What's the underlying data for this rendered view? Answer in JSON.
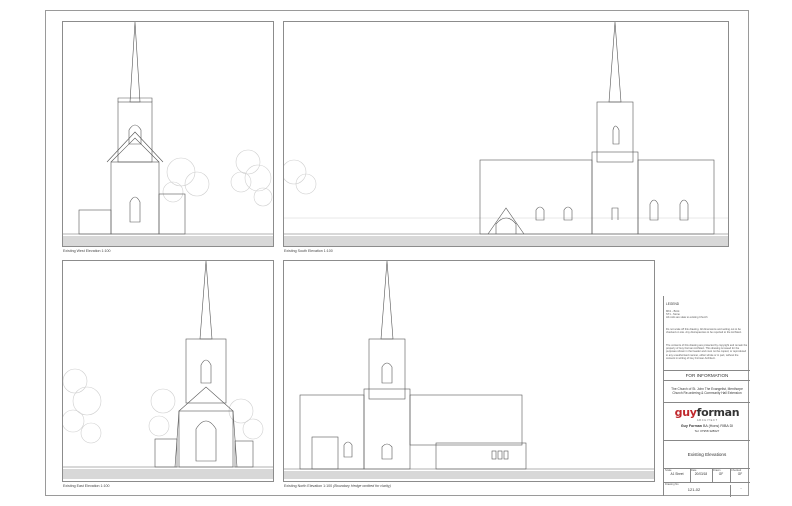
{
  "panels": {
    "west": {
      "caption": "Existing West Elevation 1:100"
    },
    "south": {
      "caption": "Existing South Elevation 1:100"
    },
    "east": {
      "caption": "Existing East Elevation 1:100"
    },
    "north": {
      "caption": "Existing North Elevation 1:100",
      "note": "(Boundary Hedge omitted for clarity)"
    }
  },
  "title_block": {
    "legend_heading": "LEGEND",
    "legend_items": [
      "MK1 - Brick",
      "ST1 - Stone",
      "All roofs are slate to existing Church"
    ],
    "notes_1": "Do not scale off this drawing. All dimensions and setting out to be checked on site. Any discrepancies to be reported to the Architect.",
    "notes_2": "The contents of this drawing are protected by copyright and remain the property of Guy Forman Architect. This drawing is issued for the purposes shown in the header and must not be copied, or reproduced in any unauthorised manner, either whole or in part, without the consent in writing of Guy Forman Architect.",
    "status": "FOR INFORMATION",
    "project_line_1": "The Church of St. John The Evangelist, Menthorpe",
    "project_line_2": "Church Re-ordering & Community Hall Extension",
    "logo_guy": "guy",
    "logo_forman": "forman",
    "logo_sub": "A R C H I T E C T",
    "architect_name": "Guy Forman",
    "architect_quals": "BA (Hons) RIBA DI",
    "phone": "Tel: 07958 328627",
    "drawing_title": "Existing Elevations",
    "scale_label": "Scale",
    "scale_value": "A1 Sheet",
    "date_label": "Date",
    "date_value": "20/03/18",
    "drawn_label": "Drawn",
    "drawn_value": "GF",
    "checked_label": "Checked",
    "checked_value": "GF",
    "drawing_no_label": "Drawing No",
    "drawing_no": "121-02",
    "revision": "-"
  }
}
